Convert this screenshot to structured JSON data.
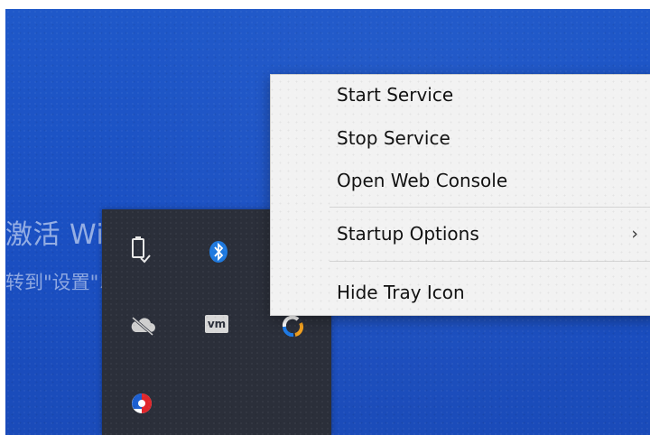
{
  "watermark": {
    "title": "激活 Windows",
    "subtitle": "转到\"设置\"以激活 Windows。"
  },
  "tray": {
    "icons": [
      {
        "name": "usb-eject-icon"
      },
      {
        "name": "bluetooth-icon",
        "color": "#1f7ae0"
      },
      {
        "name": "cloud-offline-icon"
      },
      {
        "name": "vmware-icon",
        "label": "vm"
      },
      {
        "name": "app-swirl-icon"
      },
      {
        "name": "vpn-shield-icon"
      }
    ]
  },
  "menu": {
    "items": [
      {
        "label": "Start Service"
      },
      {
        "label": "Stop Service"
      },
      {
        "label": "Open Web Console"
      },
      {
        "label": "Startup Options",
        "submenu_arrow": "›"
      },
      {
        "label": "Hide Tray Icon"
      }
    ]
  }
}
